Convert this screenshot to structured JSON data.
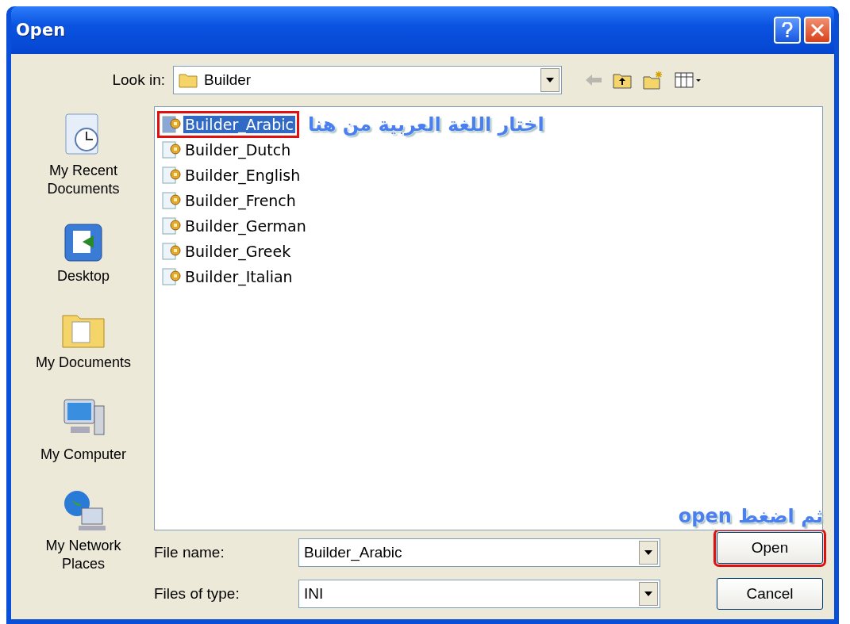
{
  "window": {
    "title": "Open"
  },
  "look_in": {
    "label": "Look in:",
    "value": "Builder"
  },
  "places": [
    {
      "label": "My Recent Documents",
      "kind": "recent"
    },
    {
      "label": "Desktop",
      "kind": "desktop"
    },
    {
      "label": "My Documents",
      "kind": "documents"
    },
    {
      "label": "My Computer",
      "kind": "computer"
    },
    {
      "label": "My Network Places",
      "kind": "network"
    }
  ],
  "files": [
    {
      "name": "Builder_Arabic",
      "selected": true,
      "highlighted": true
    },
    {
      "name": "Builder_Dutch",
      "selected": false,
      "highlighted": false
    },
    {
      "name": "Builder_English",
      "selected": false,
      "highlighted": false
    },
    {
      "name": "Builder_French",
      "selected": false,
      "highlighted": false
    },
    {
      "name": "Builder_German",
      "selected": false,
      "highlighted": false
    },
    {
      "name": "Builder_Greek",
      "selected": false,
      "highlighted": false
    },
    {
      "name": "Builder_Italian",
      "selected": false,
      "highlighted": false
    }
  ],
  "annotations": [
    {
      "text": "اختار اللغة العربية من هنا"
    },
    {
      "text": "ثم اضغط open"
    }
  ],
  "file_name": {
    "label": "File name:",
    "value": "Builder_Arabic"
  },
  "file_type": {
    "label": "Files of type:",
    "value": "INI"
  },
  "buttons": [
    {
      "label": "Open",
      "highlighted": true
    },
    {
      "label": "Cancel",
      "highlighted": false
    }
  ]
}
